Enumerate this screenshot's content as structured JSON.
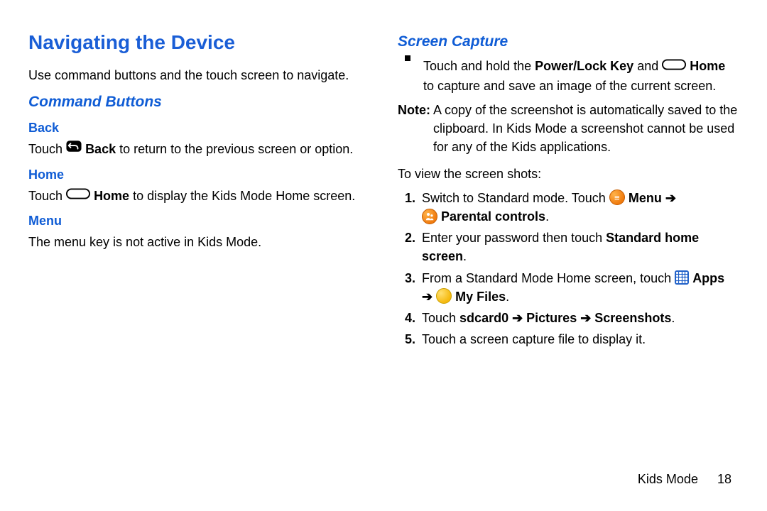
{
  "left": {
    "heading": "Navigating the Device",
    "intro": "Use command buttons and the touch screen to navigate.",
    "command_buttons_heading": "Command Buttons",
    "back": {
      "heading": "Back",
      "pre": "Touch ",
      "label_bold": "Back",
      "post": " to return to the previous screen or option."
    },
    "home": {
      "heading": "Home",
      "pre": "Touch ",
      "label_bold": "Home",
      "post": " to display the Kids Mode Home screen."
    },
    "menu": {
      "heading": "Menu",
      "text": "The menu key is not active in Kids Mode."
    }
  },
  "right": {
    "screen_capture_heading": "Screen Capture",
    "bullet": {
      "pre": "Touch and hold the ",
      "bold1": "Power/Lock Key",
      "mid": " and ",
      "bold2": "Home",
      "tail": " to capture and save an image of the current screen."
    },
    "note_label": "Note:",
    "note_text": "A copy of the screenshot is automatically saved to the clipboard. In Kids Mode a screenshot cannot be used for any of the Kids applications.",
    "to_view": "To view the screen shots:",
    "steps": {
      "s1_pre": "Switch to Standard mode. Touch ",
      "s1_menu_bold": "Menu",
      "s1_arrow": " ➔ ",
      "s1_parental_bold": "Parental controls",
      "s1_period": ".",
      "s2_pre": "Enter your password then touch ",
      "s2_bold": "Standard home screen",
      "s2_period": ".",
      "s3_pre": "From a Standard Mode Home screen, touch ",
      "s3_apps_bold": "Apps",
      "s3_arrow": " ➔ ",
      "s3_myfiles_bold": "My Files",
      "s3_period": ".",
      "s4_pre": "Touch ",
      "s4_bold": "sdcard0 ➔ Pictures ➔ Screenshots",
      "s4_period": ".",
      "s5": "Touch a screen capture file to display it."
    }
  },
  "footer": {
    "section": "Kids Mode",
    "page": "18"
  }
}
